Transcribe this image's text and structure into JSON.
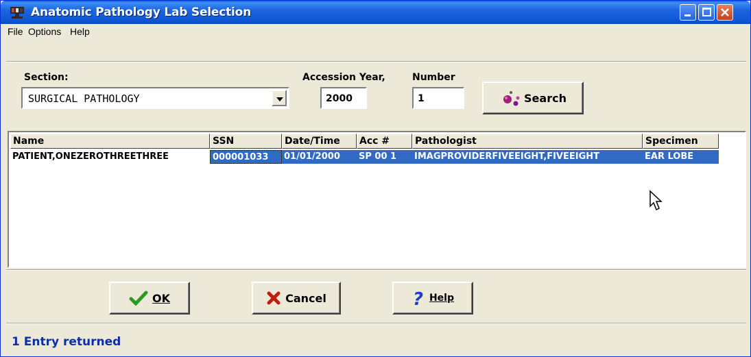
{
  "window": {
    "title": "Anatomic Pathology Lab Selection"
  },
  "menu": {
    "items": [
      "File",
      "Options",
      "Help"
    ]
  },
  "form": {
    "section_label": "Section:",
    "section_value": "SURGICAL PATHOLOGY",
    "accession_year_label": "Accession Year,",
    "accession_year_value": "2000",
    "number_label": "Number",
    "number_value": "1",
    "search_label": "Search"
  },
  "grid": {
    "columns": [
      "Name",
      "SSN",
      "Date/Time",
      "Acc #",
      "Pathologist",
      "Specimen"
    ],
    "rows": [
      {
        "name": "PATIENT,ONEZEROTHREETHREE",
        "ssn": "000001033",
        "datetime": "01/01/2000",
        "acc": "SP 00 1",
        "pathologist": "IMAGPROVIDERFIVEEIGHT,FIVEEIGHT",
        "specimen": "EAR LOBE"
      }
    ]
  },
  "buttons": {
    "ok": "OK",
    "cancel": "Cancel",
    "help": "Help"
  },
  "status": {
    "text": "1 Entry  returned"
  },
  "colors": {
    "selection": "#316ac5",
    "title_bar": "#0f55d6",
    "status_text": "#0a2fa8"
  }
}
